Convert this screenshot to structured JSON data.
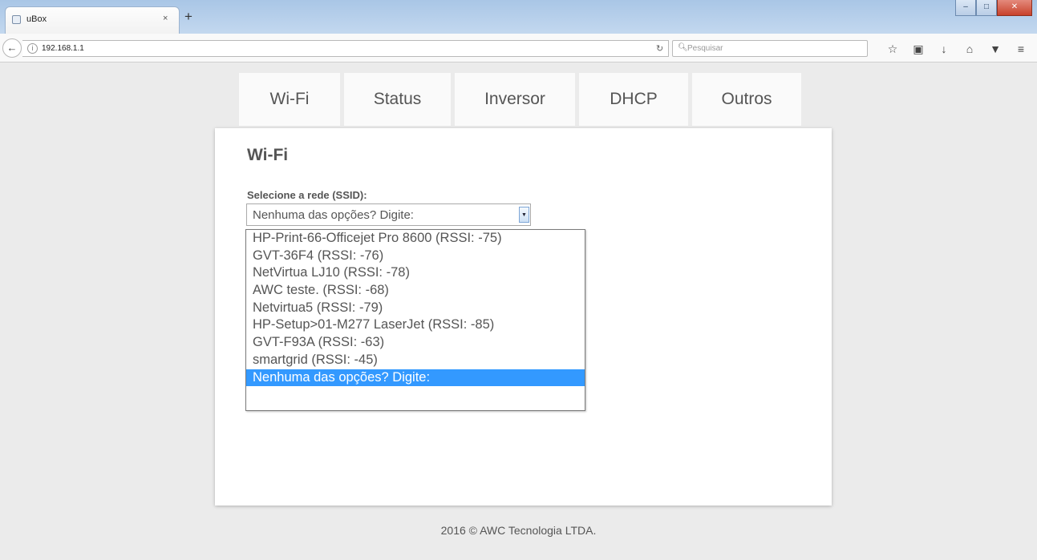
{
  "browser": {
    "tab_title": "uBox",
    "tab_close": "×",
    "new_tab": "+",
    "url": "192.168.1.1",
    "search_placeholder": "Pesquisar",
    "window_controls": {
      "minimize": "–",
      "maximize": "□",
      "close": "✕"
    },
    "toolbar_icons": [
      "star-icon",
      "library-icon",
      "download-icon",
      "home-icon",
      "pocket-icon",
      "menu-icon"
    ]
  },
  "nav": {
    "tabs": [
      {
        "label": "Wi-Fi"
      },
      {
        "label": "Status"
      },
      {
        "label": "Inversor"
      },
      {
        "label": "DHCP"
      },
      {
        "label": "Outros"
      }
    ]
  },
  "wifi": {
    "title": "Wi-Fi",
    "select_label": "Selecione a rede (SSID):",
    "select_value": "Nenhuma das opções? Digite:",
    "options": [
      "HP-Print-66-Officejet Pro 8600 (RSSI: -75)",
      "GVT-36F4 (RSSI: -76)",
      "NetVirtua LJ10 (RSSI: -78)",
      "AWC teste. (RSSI: -68)",
      "Netvirtua5 (RSSI: -79)",
      "HP-Setup>01-M277 LaserJet (RSSI: -85)",
      "GVT-F93A (RSSI: -63)",
      "smartgrid (RSSI: -45)",
      "Nenhuma das opções? Digite:"
    ],
    "selected_index": 8
  },
  "footer": {
    "text": "2016 © AWC Tecnologia LTDA."
  },
  "colors": {
    "selection": "#3399ff",
    "page_bg": "#ebebeb"
  }
}
